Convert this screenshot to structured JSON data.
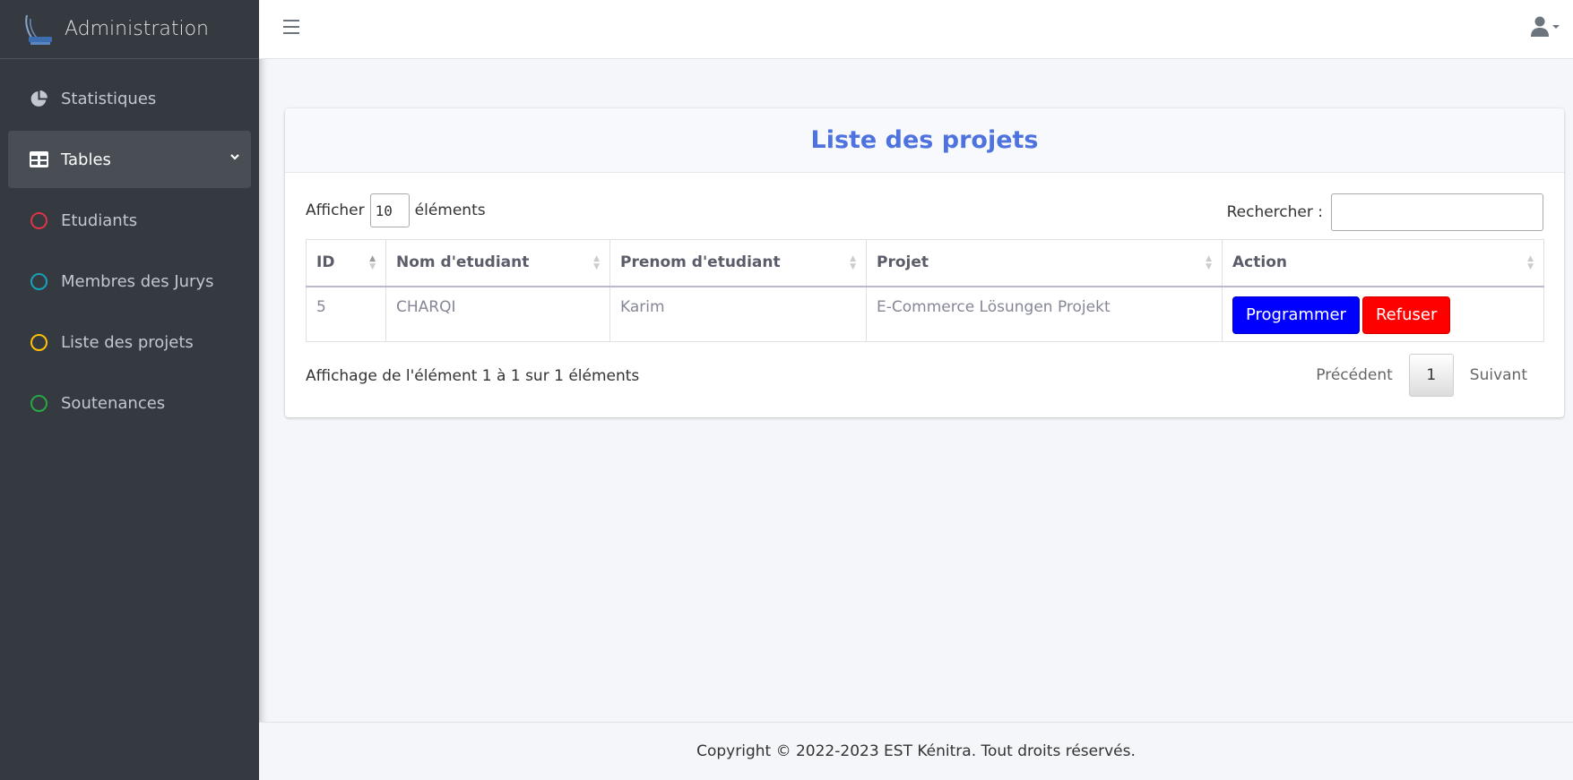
{
  "sidebar": {
    "brand": "Administration",
    "items": [
      {
        "label": "Statistiques",
        "icon": "chart-pie-icon"
      },
      {
        "label": "Tables",
        "icon": "table-icon",
        "active": true
      },
      {
        "label": "Etudiants",
        "icon": "circle-icon",
        "color": "#dc3545"
      },
      {
        "label": "Membres des Jurys",
        "icon": "circle-icon",
        "color": "#17a2b8"
      },
      {
        "label": "Liste des projets",
        "icon": "circle-icon",
        "color": "#ffc107"
      },
      {
        "label": "Soutenances",
        "icon": "circle-icon",
        "color": "#28a745"
      }
    ]
  },
  "card": {
    "title": "Liste des projets",
    "length_prefix": "Afficher",
    "length_value": "10",
    "length_suffix": "éléments",
    "search_label": "Rechercher :",
    "search_value": ""
  },
  "table": {
    "headers": [
      "ID",
      "Nom d'etudiant",
      "Prenom d'etudiant",
      "Projet",
      "Action"
    ],
    "rows": [
      {
        "id": "5",
        "nom": "CHARQI",
        "prenom": "Karim",
        "projet": "E-Commerce Lösungen Projekt",
        "btn_program": "Programmer",
        "btn_refuse": "Refuser"
      }
    ]
  },
  "info": "Affichage de l'élément 1 à 1 sur 1 éléments",
  "pager": {
    "prev": "Précédent",
    "page": "1",
    "next": "Suivant"
  },
  "footer": "Copyright © 2022-2023 EST Kénitra. Tout droits réservés.",
  "colors": {
    "accent": "#4e73df",
    "sidebar": "#343a40",
    "program": "#0000ff",
    "refuse": "#ff0000"
  }
}
